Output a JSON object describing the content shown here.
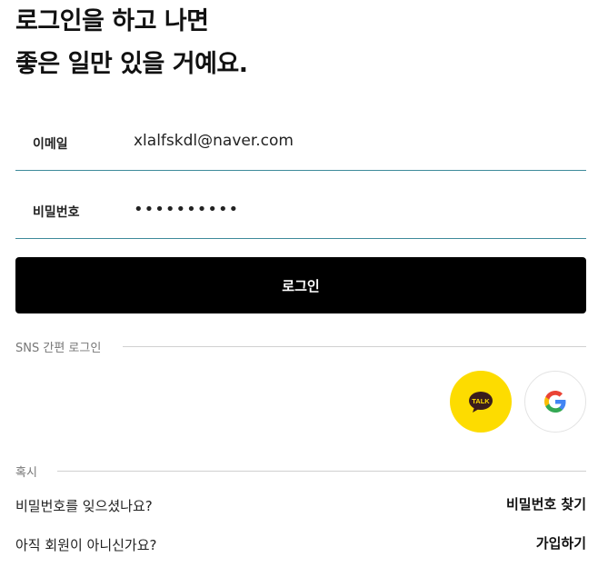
{
  "headline": {
    "line1": "로그인을 하고 나면",
    "line2": "좋은 일만 있을 거예요."
  },
  "form": {
    "email_label": "이메일",
    "email_value": "xlalfskdl@naver.com",
    "password_label": "비밀번호",
    "password_value": "••••••••••",
    "login_button": "로그인"
  },
  "sns": {
    "label": "SNS 간편 로그인",
    "kakao_text": "TALK",
    "kakao_icon": "kakao-talk-icon",
    "google_icon": "google-icon"
  },
  "help": {
    "label": "혹시",
    "forgot_text": "비밀번호를 잊으셨나요?",
    "forgot_link": "비밀번호 찾기",
    "signup_text": "아직 회원이 아니신가요?",
    "signup_link": "가입하기"
  },
  "colors": {
    "field_underline": "#3e8a9a",
    "button_bg": "#000000",
    "kakao_yellow": "#fddc00"
  }
}
